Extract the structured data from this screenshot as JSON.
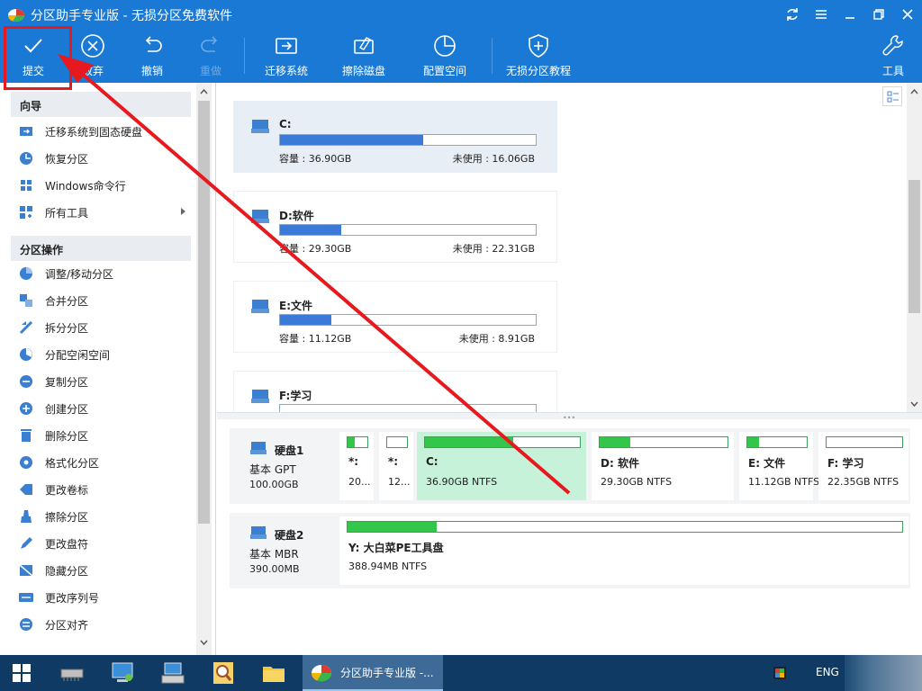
{
  "window": {
    "title": "分区助手专业版 - 无损分区免费软件"
  },
  "toolbar": {
    "submit": "提交",
    "discard": "放弃",
    "undo": "撤销",
    "redo": "重做",
    "migrate": "迁移系统",
    "wipe": "擦除磁盘",
    "alloc": "配置空间",
    "tutorial": "无损分区教程",
    "tools": "工具"
  },
  "sidebar": {
    "wizard_title": "向导",
    "wizard": [
      {
        "label": "迁移系统到固态硬盘",
        "icon": "migrate-ssd-icon"
      },
      {
        "label": "恢复分区",
        "icon": "recover-partition-icon"
      },
      {
        "label": "Windows命令行",
        "icon": "windows-cmd-icon"
      },
      {
        "label": "所有工具",
        "icon": "all-tools-icon"
      }
    ],
    "ops_title": "分区操作",
    "ops": [
      {
        "label": "调整/移动分区",
        "icon": "resize-partition-icon"
      },
      {
        "label": "合并分区",
        "icon": "merge-partition-icon"
      },
      {
        "label": "拆分分区",
        "icon": "split-partition-icon"
      },
      {
        "label": "分配空闲空间",
        "icon": "allocate-space-icon"
      },
      {
        "label": "复制分区",
        "icon": "copy-partition-icon"
      },
      {
        "label": "创建分区",
        "icon": "create-partition-icon"
      },
      {
        "label": "删除分区",
        "icon": "delete-partition-icon"
      },
      {
        "label": "格式化分区",
        "icon": "format-partition-icon"
      },
      {
        "label": "更改卷标",
        "icon": "change-label-icon"
      },
      {
        "label": "擦除分区",
        "icon": "wipe-partition-icon"
      },
      {
        "label": "更改盘符",
        "icon": "change-letter-icon"
      },
      {
        "label": "隐藏分区",
        "icon": "hide-partition-icon"
      },
      {
        "label": "更改序列号",
        "icon": "change-serial-icon"
      },
      {
        "label": "分区对齐",
        "icon": "align-partition-icon"
      }
    ]
  },
  "volumes": [
    {
      "name": "C:",
      "capacity": "容量 : 36.90GB",
      "free": "未使用 : 16.06GB",
      "used_fraction": 0.56
    },
    {
      "name": "D:软件",
      "capacity": "容量 : 29.30GB",
      "free": "未使用 : 22.31GB",
      "used_fraction": 0.24
    },
    {
      "name": "E:文件",
      "capacity": "容量 : 11.12GB",
      "free": "未使用 : 8.91GB",
      "used_fraction": 0.2
    },
    {
      "name": "F:学习"
    }
  ],
  "disks": [
    {
      "name": "硬盘1",
      "type": "基本 GPT",
      "size": "100.00GB",
      "partitions": [
        {
          "name": "*:",
          "desc": "20...",
          "used_fraction": 0.35
        },
        {
          "name": "*:",
          "desc": "12...",
          "used_fraction": 0.0
        },
        {
          "name": "C:",
          "desc": "36.90GB NTFS",
          "used_fraction": 0.57
        },
        {
          "name": "D: 软件",
          "desc": "29.30GB NTFS",
          "used_fraction": 0.24
        },
        {
          "name": "E: 文件",
          "desc": "11.12GB NTFS",
          "used_fraction": 0.2
        },
        {
          "name": "F: 学习",
          "desc": "22.35GB NTFS",
          "used_fraction": 0.0
        }
      ]
    },
    {
      "name": "硬盘2",
      "type": "基本 MBR",
      "size": "390.00MB",
      "partitions": [
        {
          "name": "Y: 大白菜PE工具盘",
          "desc": "388.94MB NTFS",
          "used_fraction": 0.16
        }
      ]
    }
  ],
  "taskbar": {
    "active_app": "分区助手专业版 -...",
    "lang": "ENG"
  },
  "colors": {
    "accent": "#1a79d5",
    "volume_bar": "#3c7ad8",
    "partition_bar": "#34c64a",
    "annotation": "#e8191e"
  }
}
